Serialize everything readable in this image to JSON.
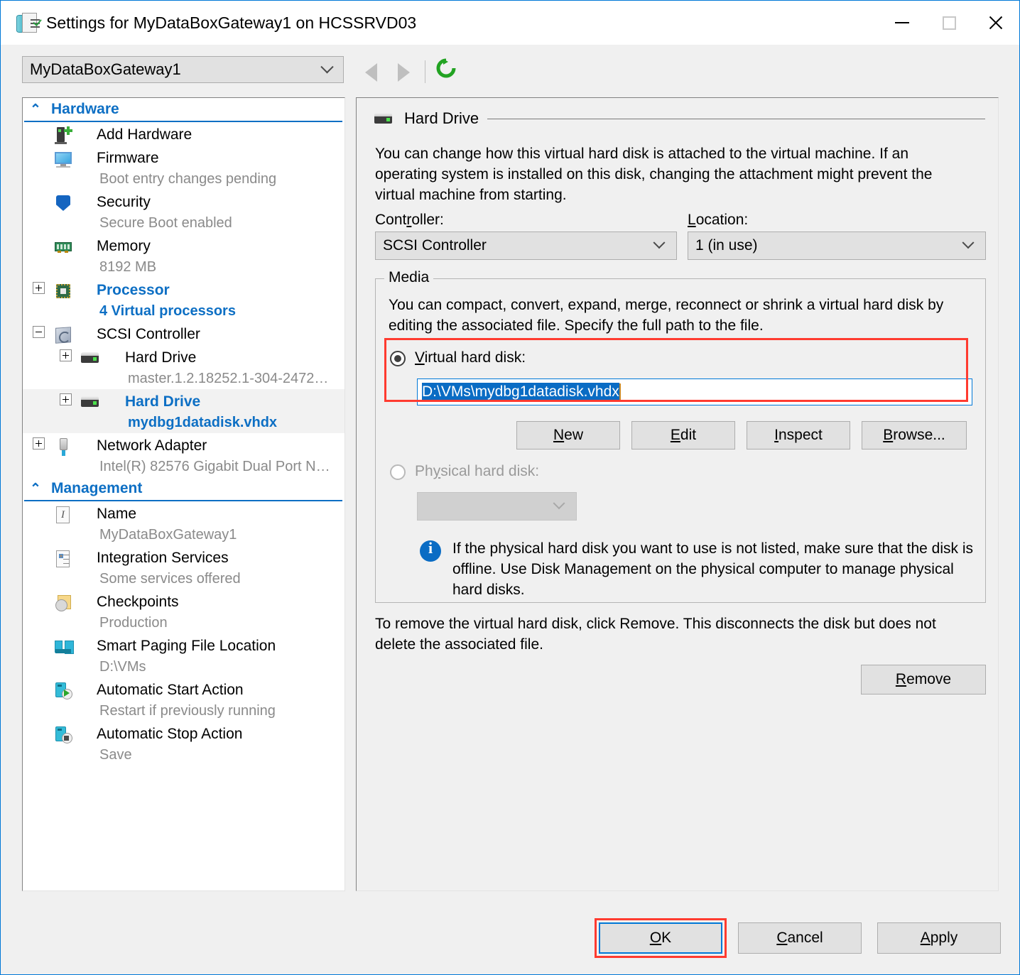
{
  "window": {
    "title": "Settings for MyDataBoxGateway1 on HCSSRVD03",
    "icon": "vm-settings-icon",
    "minimize_label": "Minimize",
    "maximize_label": "Maximize",
    "close_label": "Close"
  },
  "toolbar": {
    "vm_selector_value": "MyDataBoxGateway1",
    "back_label": "Back",
    "forward_label": "Forward",
    "refresh_label": "Refresh"
  },
  "sidebar": {
    "groups": [
      {
        "label": "Hardware"
      },
      {
        "label": "Management"
      }
    ],
    "hardware_items": [
      {
        "label": "Add Hardware",
        "sub": "",
        "icon": "add-hardware-icon",
        "expander": false,
        "selected": false
      },
      {
        "label": "Firmware",
        "sub": "Boot entry changes pending",
        "icon": "firmware-icon",
        "expander": false,
        "selected": false
      },
      {
        "label": "Security",
        "sub": "Secure Boot enabled",
        "icon": "security-shield-icon",
        "expander": false,
        "selected": false
      },
      {
        "label": "Memory",
        "sub": "8192 MB",
        "icon": "memory-icon",
        "expander": false,
        "selected": false
      },
      {
        "label": "Processor",
        "sub": "4 Virtual processors",
        "icon": "processor-icon",
        "expander": "plus",
        "selected": false
      },
      {
        "label": "SCSI Controller",
        "sub": "",
        "icon": "scsi-controller-icon",
        "expander": "minus",
        "selected": false
      },
      {
        "label": "Hard Drive",
        "sub": "master.1.2.18252.1-304-2472…",
        "icon": "hard-drive-icon",
        "expander": "plus",
        "selected": false
      },
      {
        "label": "Hard Drive",
        "sub": "mydbg1datadisk.vhdx",
        "icon": "hard-drive-icon",
        "expander": "plus",
        "selected": true
      },
      {
        "label": "Network Adapter",
        "sub": "Intel(R) 82576 Gigabit Dual Port N…",
        "icon": "network-adapter-icon",
        "expander": "plus",
        "selected": false
      }
    ],
    "management_items": [
      {
        "label": "Name",
        "sub": "MyDataBoxGateway1",
        "icon": "name-icon"
      },
      {
        "label": "Integration Services",
        "sub": "Some services offered",
        "icon": "integration-services-icon"
      },
      {
        "label": "Checkpoints",
        "sub": "Production",
        "icon": "checkpoints-icon"
      },
      {
        "label": "Smart Paging File Location",
        "sub": "D:\\VMs",
        "icon": "smart-paging-icon"
      },
      {
        "label": "Automatic Start Action",
        "sub": "Restart if previously running",
        "icon": "automatic-start-icon"
      },
      {
        "label": "Automatic Stop Action",
        "sub": "Save",
        "icon": "automatic-stop-icon"
      }
    ]
  },
  "main": {
    "section_title": "Hard Drive",
    "section_icon": "hard-drive-icon",
    "description": "You can change how this virtual hard disk is attached to the virtual machine. If an operating system is installed on this disk, changing the attachment might prevent the virtual machine from starting.",
    "controller_label": "Controller:",
    "controller_value": "SCSI Controller",
    "location_label": "Location:",
    "location_value": "1 (in use)",
    "media": {
      "legend": "Media",
      "description": "You can compact, convert, expand, merge, reconnect or shrink a virtual hard disk by editing the associated file. Specify the full path to the file.",
      "virtual_hard_disk_label": "Virtual hard disk:",
      "virtual_hard_disk_path": "D:\\VMs\\mydbg1datadisk.vhdx",
      "virtual_selected": true,
      "buttons": [
        {
          "label": "New",
          "accesskey": "N"
        },
        {
          "label": "Edit",
          "accesskey": "E"
        },
        {
          "label": "Inspect",
          "accesskey": "I"
        },
        {
          "label": "Browse...",
          "accesskey": "B"
        }
      ],
      "physical_hard_disk_label": "Physical hard disk:",
      "physical_selected": false,
      "physical_value": "",
      "info_text": "If the physical hard disk you want to use is not listed, make sure that the disk is offline. Use Disk Management on the physical computer to manage physical hard disks."
    },
    "remove_description": "To remove the virtual hard disk, click Remove. This disconnects the disk but does not delete the associated file.",
    "remove_button": "Remove"
  },
  "footer": {
    "ok_label": "OK",
    "cancel_label": "Cancel",
    "apply_label": "Apply"
  },
  "colors": {
    "accent": "#0078d7",
    "link_blue": "#0d6fc4",
    "annotation_red": "#ff3b30",
    "selection_blue": "#0a6cc4",
    "refresh_green": "#22a322"
  }
}
